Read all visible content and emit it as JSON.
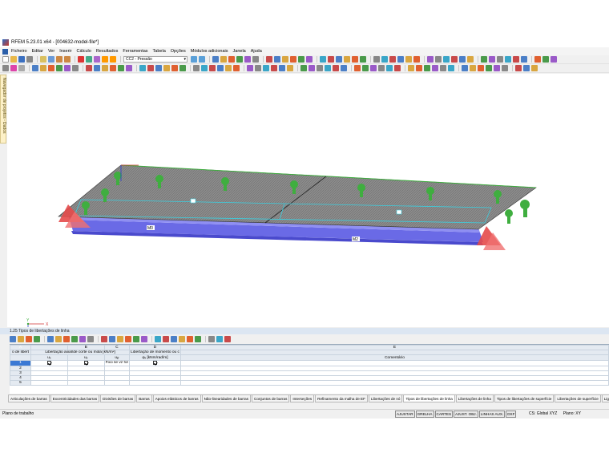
{
  "window": {
    "title": "RFEM 5.23.01 x64 - [004632-model-file*]"
  },
  "menu": [
    "Ficheiro",
    "Editar",
    "Ver",
    "Inserir",
    "Cálculo",
    "Resultados",
    "Ferramentas",
    "Tabela",
    "Opções",
    "Módulos adicionais",
    "Janela",
    "Ajuda"
  ],
  "toolbar": {
    "load_case": "CC2 - Pressão"
  },
  "navigator": {
    "label": "Navegador de projetos - Dados"
  },
  "model": {
    "member_labels": [
      "M0",
      "M2"
    ],
    "axes": {
      "x": "X",
      "y": "Y",
      "z": "Z"
    }
  },
  "panel": {
    "title": "1.25 Tipos de libertações de linha",
    "columns": {
      "letters": [
        "A",
        "B",
        "C",
        "D",
        "E"
      ],
      "row_header": "o de libert",
      "group_axial": "Libertação axial/de corte ou mola [kN/m²]",
      "group_moment": "Libertação de momento ou c",
      "ux": "uₓ",
      "uy": "uᵧ",
      "uz": "u𝓏",
      "phix": "φₓ [kNm/rad/m]",
      "comment": "Comentário"
    },
    "rows": [
      {
        "no": "1",
        "ux": true,
        "uy": true,
        "uz": "Fixo se vz for",
        "phix": true,
        "comment": ""
      },
      {
        "no": "2",
        "ux": false,
        "uy": false,
        "uz": "",
        "phix": false,
        "comment": ""
      },
      {
        "no": "3",
        "ux": false,
        "uy": false,
        "uz": "",
        "phix": false,
        "comment": ""
      },
      {
        "no": "4",
        "ux": false,
        "uy": false,
        "uz": "",
        "phix": false,
        "comment": ""
      },
      {
        "no": "5",
        "ux": false,
        "uy": false,
        "uz": "",
        "phix": false,
        "comment": ""
      }
    ]
  },
  "tabs": [
    "Articulações de barras",
    "Excentricidades das barras",
    "Divisões de barras",
    "Barras",
    "Apoios elásticos de barras",
    "Não-linearidades de barras",
    "Conjuntos de barras",
    "Interseções",
    "Refinamento da malha de EF",
    "Libertações de nó",
    "Tipos de libertações de linha",
    "Libertações de linha",
    "Tipos de libertações de superfície",
    "Libertações de superfície",
    "Ligaçõ"
  ],
  "active_tab": 10,
  "status": {
    "left": "Plano de trabalho",
    "buttons": [
      "AJUSTAR",
      "GRELHA",
      "CARTES",
      "AJUST. OBJ.",
      "LINHAS AUX.",
      "DXF"
    ],
    "cs": "CS: Global XYZ",
    "plane": "Plano: XY"
  },
  "colors": {
    "member": "#6a6ae6",
    "support": "#e44a4a",
    "load": "#3fae3f",
    "panel_header": "#dce6f2"
  }
}
